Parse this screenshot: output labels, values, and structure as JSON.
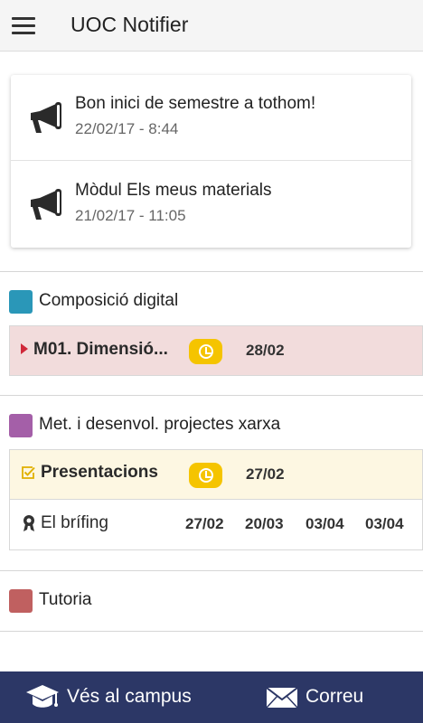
{
  "appbar": {
    "title": "UOC Notifier",
    "menu_icon": "menu-icon"
  },
  "notifications": [
    {
      "icon": "megaphone-icon",
      "title": "Bon inici de semestre a tothom!",
      "date": "22/02/17 - 8:44"
    },
    {
      "icon": "megaphone-icon",
      "title": "Mòdul Els meus materials",
      "date": "21/02/17 - 11:05"
    }
  ],
  "subjects": [
    {
      "name": "Composició digital",
      "color": "#2a97b8",
      "rows": [
        {
          "icon": "caret-right-icon",
          "label": "M01. Dimensió...",
          "badge": "clock-icon",
          "date": "28/02"
        }
      ]
    },
    {
      "name": "Met. i desenvol. projectes xarxa",
      "color": "#a45fa8",
      "rows": [
        {
          "icon": "checkbox-checked-icon",
          "label": "Presentacions",
          "badge": "clock-icon",
          "date": "27/02"
        },
        {
          "icon": "award-icon",
          "label": "El brífing",
          "dates": [
            "27/02",
            "20/03",
            "03/04",
            "03/04"
          ]
        }
      ]
    },
    {
      "name": "Tutoria",
      "color": "#c06060",
      "rows": []
    }
  ],
  "bottom_bar": {
    "campus_label": "Vés al campus",
    "campus_icon": "graduation-cap-icon",
    "mail_label": "Correu",
    "mail_icon": "envelope-icon"
  },
  "colors": {
    "appbar_bg": "#f5f5f5",
    "bottom_bar_bg": "#2c3766",
    "badge_yellow": "#f5c400",
    "row_pink": "#f2dcdc",
    "row_yellow": "#fdf7e2"
  }
}
